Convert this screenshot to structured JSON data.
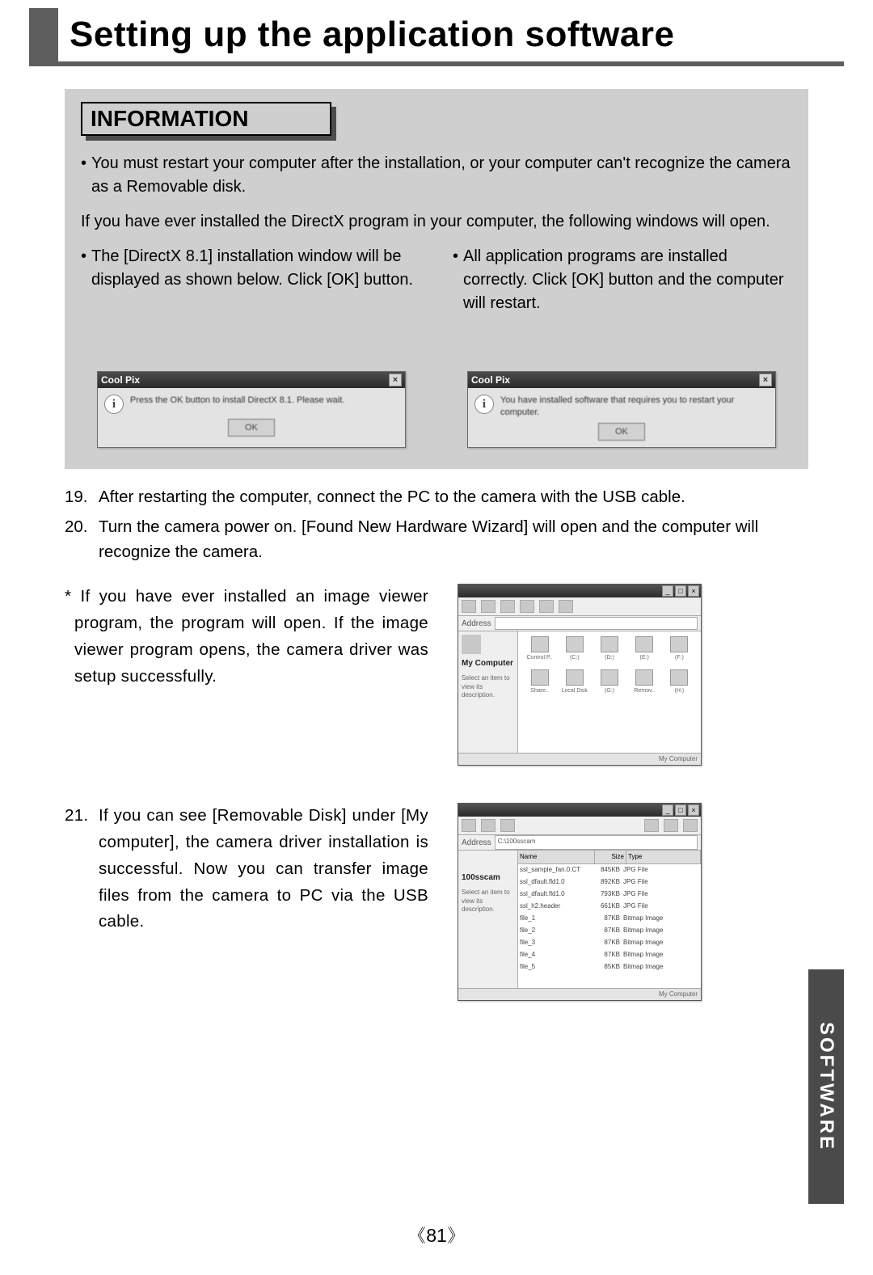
{
  "header": {
    "title": "Setting up the application software"
  },
  "info": {
    "heading": "INFORMATION",
    "restart_note": "You must restart your computer after the installation, or your computer can't recognize the camera as a Removable disk.",
    "directx_note": "If you have ever installed the DirectX program in your computer, the following windows will open.",
    "col_left": "The [DirectX 8.1] installation window will be displayed as shown below. Click [OK] button.",
    "col_right": "All application programs are installed correctly. Click [OK] button and the computer will restart.",
    "dialog1": {
      "title": "Cool Pix",
      "message": "Press the OK button to install DirectX 8.1. Please wait.",
      "ok": "OK"
    },
    "dialog2": {
      "title": "Cool Pix",
      "message": "You have installed software that requires you to restart your computer.",
      "ok": "OK"
    }
  },
  "steps": {
    "s19": {
      "num": "19.",
      "text": "After restarting the computer, connect the PC to the camera with the USB cable."
    },
    "s20": {
      "num": "20.",
      "text": "Turn the camera power on. [Found New Hardware Wizard] will open and the computer will recognize the camera."
    },
    "s20_note": "If you have ever installed an image viewer program, the program will open. If the image viewer program opens, the camera driver was setup successfully.",
    "s21": {
      "num": "21.",
      "text": "If you can see [Removable Disk] under [My computer], the camera driver installation is successful. Now you can transfer image files from the camera to PC via the USB cable."
    }
  },
  "windows": {
    "mycomputer": {
      "side_label": "My Computer",
      "icons": [
        "Control P..",
        "(C:)",
        "(D:)",
        "(E:)",
        "(F:)",
        "Share..",
        "Local Disk",
        "(G:)",
        "Remov..",
        "(H:)"
      ]
    },
    "explorer": {
      "side_label": "100sscam",
      "address": "C:\\100sscam",
      "headers": [
        "Name",
        "Size",
        "Type"
      ],
      "rows": [
        {
          "n": "ssl_sample_fan.0.CT",
          "s": "845KB",
          "t": "JPG File"
        },
        {
          "n": "ssl_dfault.fld1.0",
          "s": "892KB",
          "t": "JPG File"
        },
        {
          "n": "ssl_dfault.fld1.0",
          "s": "793KB",
          "t": "JPG File"
        },
        {
          "n": "ssl_h2.header",
          "s": "661KB",
          "t": "JPG File"
        },
        {
          "n": "file_1",
          "s": "87KB",
          "t": "Bitmap Image"
        },
        {
          "n": "file_2",
          "s": "87KB",
          "t": "Bitmap Image"
        },
        {
          "n": "file_3",
          "s": "87KB",
          "t": "Bitmap Image"
        },
        {
          "n": "file_4",
          "s": "87KB",
          "t": "Bitmap Image"
        },
        {
          "n": "file_5",
          "s": "85KB",
          "t": "Bitmap Image"
        }
      ],
      "status": "My Computer"
    }
  },
  "side_tab": "SOFTWARE",
  "page_number": "81"
}
